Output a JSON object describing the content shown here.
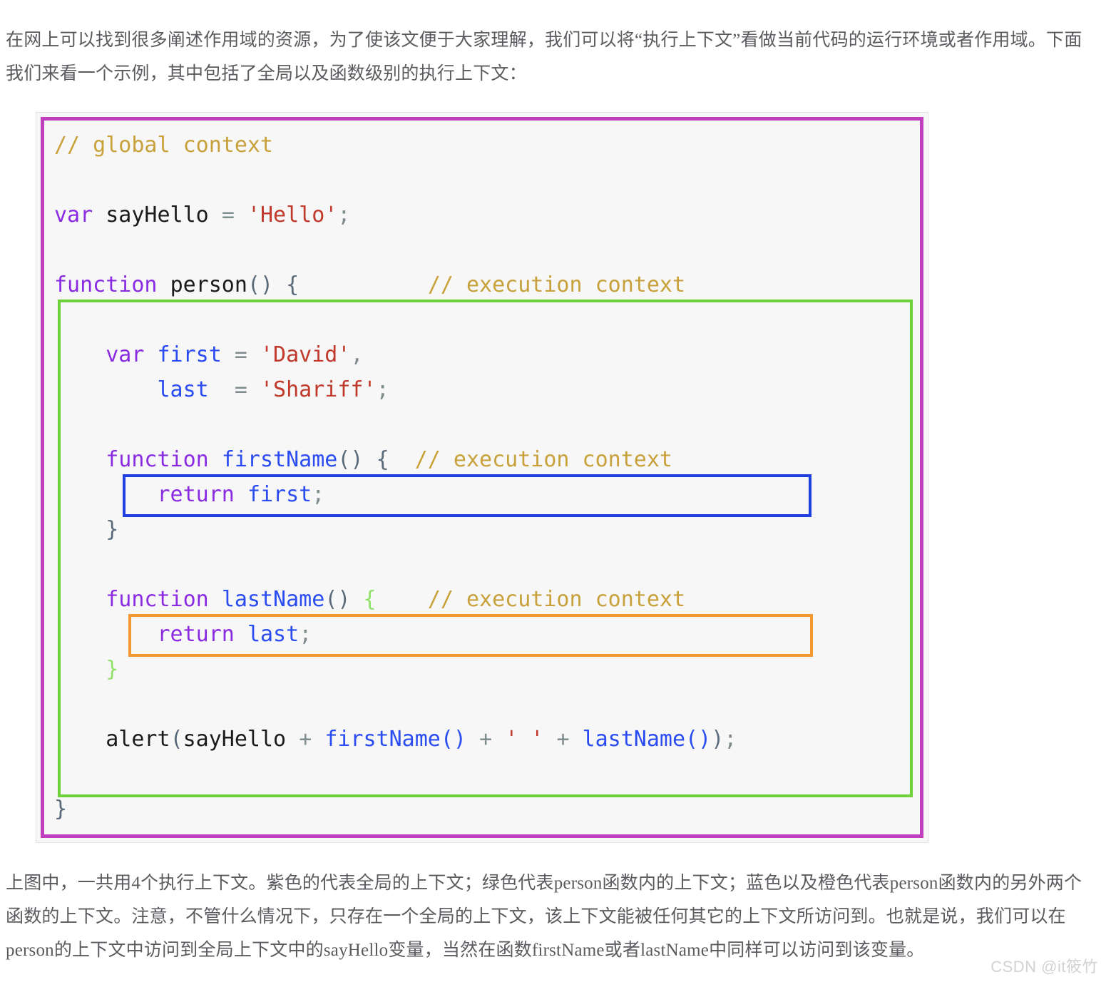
{
  "article": {
    "intro_paragraph": "在网上可以找到很多阐述作用域的资源，为了使该文便于大家理解，我们可以将“执行上下文”看做当前代码的运行环境或者作用域。下面我们来看一个示例，其中包括了全局以及函数级别的执行上下文：",
    "closing_paragraph": "上图中，一共用4个执行上下文。紫色的代表全局的上下文；绿色代表person函数内的上下文；蓝色以及橙色代表person函数内的另外两个函数的上下文。注意，不管什么情况下，只存在一个全局的上下文，该上下文能被任何其它的上下文所访问到。也就是说，我们可以在person的上下文中访问到全局上下文中的sayHello变量，当然在函数firstName或者lastName中同样可以访问到该变量。"
  },
  "code_figure": {
    "language": "javascript",
    "lines": [
      "// global context",
      "",
      "var sayHello = 'Hello';",
      "",
      "function person() {          // execution context",
      "",
      "    var first = 'David',",
      "        last  = 'Shariff';",
      "",
      "    function firstName() {  // execution context",
      "        return first;",
      "    }",
      "",
      "    function lastName() {    // execution context",
      "        return last;",
      "    }",
      "",
      "    alert(sayHello + firstName() + ' ' + lastName());",
      "",
      "}"
    ],
    "annotations": [
      {
        "name": "global-context",
        "label": "global context",
        "color": "#bf3fbf"
      },
      {
        "name": "person-context",
        "label": "person execution context",
        "color": "#6ed13b"
      },
      {
        "name": "firstName-context",
        "label": "firstName execution context",
        "color": "#1f3fe0"
      },
      {
        "name": "lastName-context",
        "label": "lastName execution context",
        "color": "#f0992e"
      }
    ],
    "tokens": {
      "comment_global": "// global context",
      "comment_execution": "// execution context",
      "keyword_var": "var",
      "keyword_function": "function",
      "keyword_return": "return",
      "name_sayHello": "sayHello",
      "name_person": "person",
      "name_first": "first",
      "name_last": "last",
      "name_firstName": "firstName",
      "name_lastName": "lastName",
      "name_alert": "alert",
      "string_hello": "'Hello'",
      "string_david": "'David'",
      "string_shariff": "'Shariff'",
      "string_space": "' '"
    }
  },
  "watermark": {
    "text": "CSDN @it筱竹"
  }
}
